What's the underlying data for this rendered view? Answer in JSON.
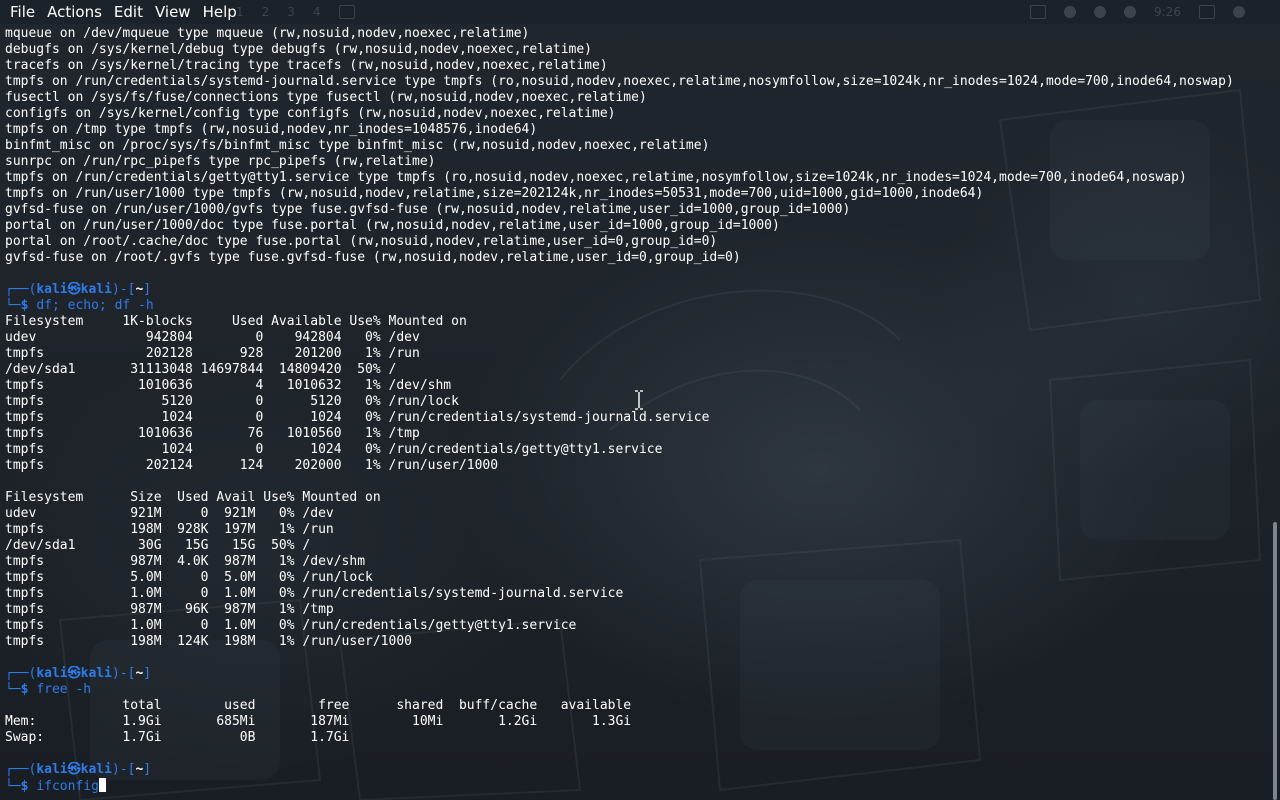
{
  "menu": {
    "items": [
      "File",
      "Actions",
      "Edit",
      "View",
      "Help"
    ]
  },
  "panel": {
    "workspaces": [
      "1",
      "2",
      "3",
      "4"
    ],
    "clock": "9:26"
  },
  "terminal": {
    "mount_lines": [
      "mqueue on /dev/mqueue type mqueue (rw,nosuid,nodev,noexec,relatime)",
      "debugfs on /sys/kernel/debug type debugfs (rw,nosuid,nodev,noexec,relatime)",
      "tracefs on /sys/kernel/tracing type tracefs (rw,nosuid,nodev,noexec,relatime)",
      "tmpfs on /run/credentials/systemd-journald.service type tmpfs (ro,nosuid,nodev,noexec,relatime,nosymfollow,size=1024k,nr_inodes=1024,mode=700,inode64,noswap)",
      "fusectl on /sys/fs/fuse/connections type fusectl (rw,nosuid,nodev,noexec,relatime)",
      "configfs on /sys/kernel/config type configfs (rw,nosuid,nodev,noexec,relatime)",
      "tmpfs on /tmp type tmpfs (rw,nosuid,nodev,nr_inodes=1048576,inode64)",
      "binfmt_misc on /proc/sys/fs/binfmt_misc type binfmt_misc (rw,nosuid,nodev,noexec,relatime)",
      "sunrpc on /run/rpc_pipefs type rpc_pipefs (rw,relatime)",
      "tmpfs on /run/credentials/getty@tty1.service type tmpfs (ro,nosuid,nodev,noexec,relatime,nosymfollow,size=1024k,nr_inodes=1024,mode=700,inode64,noswap)",
      "tmpfs on /run/user/1000 type tmpfs (rw,nosuid,nodev,relatime,size=202124k,nr_inodes=50531,mode=700,uid=1000,gid=1000,inode64)",
      "gvfsd-fuse on /run/user/1000/gvfs type fuse.gvfsd-fuse (rw,nosuid,nodev,relatime,user_id=1000,group_id=1000)",
      "portal on /run/user/1000/doc type fuse.portal (rw,nosuid,nodev,relatime,user_id=1000,group_id=1000)",
      "portal on /root/.cache/doc type fuse.portal (rw,nosuid,nodev,relatime,user_id=0,group_id=0)",
      "gvfsd-fuse on /root/.gvfs type fuse.gvfsd-fuse (rw,nosuid,nodev,relatime,user_id=0,group_id=0)"
    ],
    "prompt": {
      "frame_top_left": "┌──(",
      "user": "kali",
      "at": "㉿",
      "host": "kali",
      "mid": ")-[",
      "dir": "~",
      "end": "]",
      "frame_bottom": "└─",
      "dollar": "$"
    },
    "cmd_df": "df; echo; df -h",
    "df_lines": [
      "Filesystem     1K-blocks     Used Available Use% Mounted on",
      "udev              942804        0    942804   0% /dev",
      "tmpfs             202128      928    201200   1% /run",
      "/dev/sda1       31113048 14697844  14809420  50% /",
      "tmpfs            1010636        4   1010632   1% /dev/shm",
      "tmpfs               5120        0      5120   0% /run/lock",
      "tmpfs               1024        0      1024   0% /run/credentials/systemd-journald.service",
      "tmpfs            1010636       76   1010560   1% /tmp",
      "tmpfs               1024        0      1024   0% /run/credentials/getty@tty1.service",
      "tmpfs             202124      124    202000   1% /run/user/1000"
    ],
    "dfh_lines": [
      "Filesystem      Size  Used Avail Use% Mounted on",
      "udev            921M     0  921M   0% /dev",
      "tmpfs           198M  928K  197M   1% /run",
      "/dev/sda1        30G   15G   15G  50% /",
      "tmpfs           987M  4.0K  987M   1% /dev/shm",
      "tmpfs           5.0M     0  5.0M   0% /run/lock",
      "tmpfs           1.0M     0  1.0M   0% /run/credentials/systemd-journald.service",
      "tmpfs           987M   96K  987M   1% /tmp",
      "tmpfs           1.0M     0  1.0M   0% /run/credentials/getty@tty1.service",
      "tmpfs           198M  124K  198M   1% /run/user/1000"
    ],
    "cmd_free": "free -h",
    "free_lines": [
      "               total        used        free      shared  buff/cache   available",
      "Mem:           1.9Gi       685Mi       187Mi        10Mi       1.2Gi       1.3Gi",
      "Swap:          1.7Gi          0B       1.7Gi"
    ],
    "cmd_current": "ifconfig"
  },
  "colors": {
    "prompt": "#2f7be8",
    "text": "#ffffff",
    "background": "#1c2128"
  }
}
